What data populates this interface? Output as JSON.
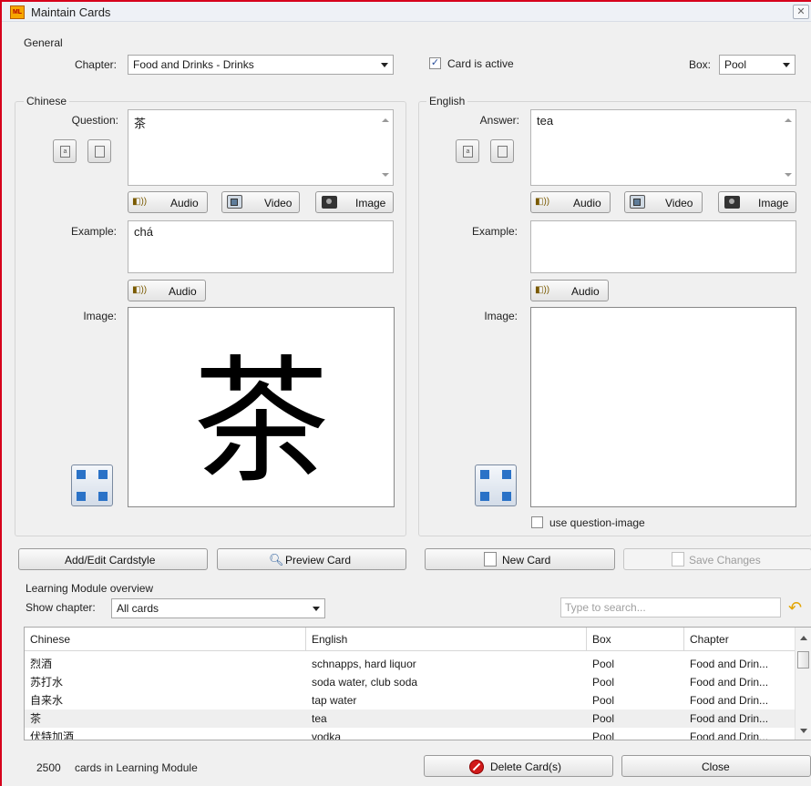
{
  "window": {
    "title": "Maintain Cards",
    "close_glyph": "✕"
  },
  "general": {
    "section_label": "General",
    "chapter_label": "Chapter:",
    "chapter_value": "Food and Drinks - Drinks",
    "card_active_label": "Card is active",
    "card_active_checked": true,
    "box_label": "Box:",
    "box_value": "Pool"
  },
  "chinese": {
    "section_label": "Chinese",
    "question_label": "Question:",
    "question_value": "茶",
    "example_label": "Example:",
    "example_value": "chá",
    "image_label": "Image:",
    "image_glyph": "茶"
  },
  "english": {
    "section_label": "English",
    "answer_label": "Answer:",
    "answer_value": "tea",
    "example_label": "Example:",
    "example_value": "",
    "image_label": "Image:",
    "use_question_image_label": "use question-image"
  },
  "media_buttons": {
    "audio": "Audio",
    "video": "Video",
    "image": "Image"
  },
  "actions": {
    "add_edit_cardstyle": "Add/Edit Cardstyle",
    "preview_card": "Preview Card",
    "new_card": "New Card",
    "save_changes": "Save Changes"
  },
  "overview": {
    "section_label": "Learning Module overview",
    "show_chapter_label": "Show chapter:",
    "show_chapter_value": "All cards",
    "search_placeholder": "Type to search...",
    "columns": [
      "Chinese",
      "English",
      "Box",
      "Chapter"
    ],
    "rows": [
      [
        "烈酒",
        "schnapps, hard liquor",
        "Pool",
        "Food and Drin..."
      ],
      [
        "苏打水",
        "soda water, club soda",
        "Pool",
        "Food and Drin..."
      ],
      [
        "自来水",
        "tap water",
        "Pool",
        "Food and Drin..."
      ],
      [
        "茶",
        "tea",
        "Pool",
        "Food and Drin..."
      ],
      [
        "伏特加酒",
        "vodka",
        "Pool",
        "Food and Drin..."
      ]
    ],
    "selected_row_index": 3
  },
  "footer": {
    "card_count": "2500",
    "card_count_suffix": "cards in Learning Module",
    "delete_button": "Delete Card(s)",
    "close_button": "Close"
  },
  "icons": {
    "app_logo": "app-logo-icon",
    "audio": "speaker-icon",
    "video": "video-icon",
    "image": "camera-icon",
    "undo": "undo-arrow-icon",
    "delete": "no-entry-icon",
    "preview": "magnifier-icon",
    "new_card": "new-document-icon",
    "save": "save-edit-icon",
    "expand": "expand-icon"
  },
  "colors": {
    "window_border": "#d6001c",
    "delete_icon": "#d01a1a",
    "undo_icon": "#e3a400"
  }
}
